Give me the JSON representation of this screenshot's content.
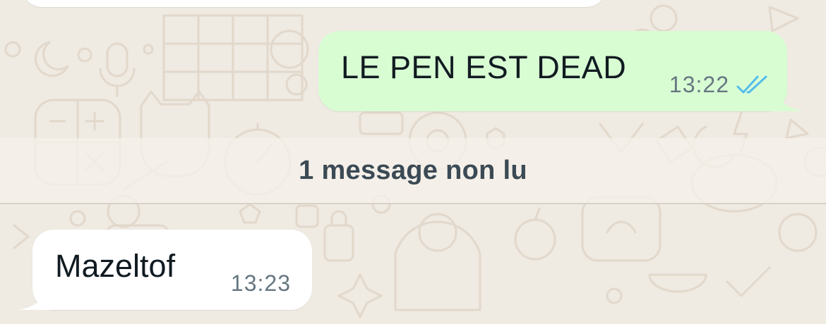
{
  "messages": [
    {
      "direction": "outgoing",
      "text": "LE PEN EST DEAD",
      "time": "13:22",
      "status_icon": "double-check-read-icon"
    },
    {
      "direction": "incoming",
      "text": "Mazeltof",
      "time": "13:23"
    }
  ],
  "unread_divider": {
    "label": "1 message non lu"
  },
  "colors": {
    "background": "#efeae2",
    "outgoing_bubble": "#d9fdd3",
    "incoming_bubble": "#ffffff",
    "read_ticks": "#53bdeb",
    "timestamp": "#667781"
  }
}
